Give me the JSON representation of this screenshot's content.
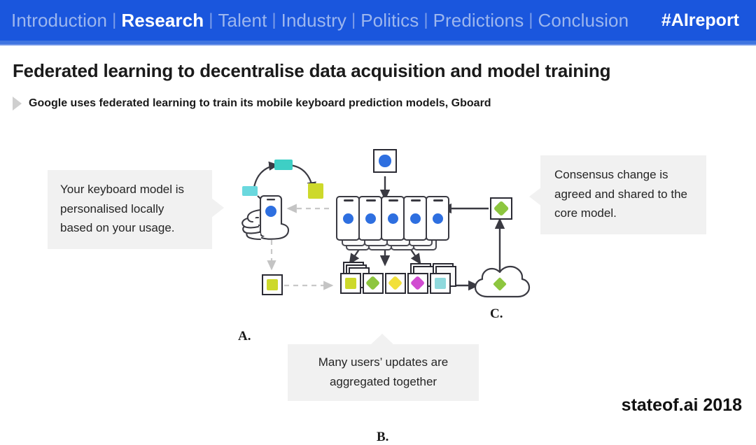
{
  "nav": {
    "items": [
      {
        "label": "Introduction",
        "active": false
      },
      {
        "label": "Research",
        "active": true
      },
      {
        "label": "Talent",
        "active": false
      },
      {
        "label": "Industry",
        "active": false
      },
      {
        "label": "Politics",
        "active": false
      },
      {
        "label": "Predictions",
        "active": false
      },
      {
        "label": "Conclusion",
        "active": false
      }
    ],
    "separator": "|",
    "hashtag": "#AIreport",
    "bar_color": "#1a56dd",
    "active_color": "#ffffff",
    "inactive_color": "#9cb6ee"
  },
  "header": {
    "title": "Federated learning to decentralise data acquisition and model training",
    "subtitle": "Google uses federated learning to train its mobile keyboard prediction models, Gboard",
    "bullet_icon": "triangle-right-icon"
  },
  "callouts": {
    "left": {
      "text": "Your keyboard model is personalised locally based on your usage.",
      "pointer": "right"
    },
    "right": {
      "text": "Consensus change is agreed and shared to the core model.",
      "pointer": "left"
    },
    "bottom": {
      "text": "Many users’ updates are aggregated together",
      "pointer": "up"
    }
  },
  "diagram": {
    "labels": {
      "a": "A.",
      "b": "B.",
      "c": "C."
    },
    "colors": {
      "phone_dot": "#2e6fe0",
      "tile_blue": "#2e6fe0",
      "tile_green": "#8dc63f",
      "tile_yellowgreen": "#cdd92b",
      "tile_cyan": "#6ad8de",
      "tile_teal": "#3ecfc5",
      "tile_yellow": "#f2e03a",
      "tile_magenta": "#d14cd1",
      "tile_lightblue": "#8fd9dd",
      "outline": "#2b2b34",
      "arrow": "#3a3a42",
      "dashed_arrow": "#c8c8c8"
    },
    "tiles_b": [
      {
        "name": "tile-b-1",
        "color": "#cdd92b",
        "shape": "square",
        "stack": true
      },
      {
        "name": "tile-b-2",
        "color": "#8dc63f",
        "shape": "diamond",
        "stack": false
      },
      {
        "name": "tile-b-3",
        "color": "#f2e03a",
        "shape": "diamond",
        "stack": false
      },
      {
        "name": "tile-b-4",
        "color": "#d14cd1",
        "shape": "diamond",
        "stack": true
      },
      {
        "name": "tile-b-5",
        "color": "#8fd9dd",
        "shape": "square",
        "stack": true
      }
    ],
    "tiles_a": [
      {
        "name": "tile-a-cyan",
        "color": "#6ad8de",
        "shape": "square"
      },
      {
        "name": "tile-a-teal",
        "color": "#3ecfc5",
        "shape": "square"
      },
      {
        "name": "tile-a-green",
        "color": "#cdd92b",
        "shape": "square"
      }
    ],
    "phone_count": 5,
    "cloud_blob_color": "#8dc63f"
  },
  "footer": {
    "text": "stateof.ai 2018"
  }
}
